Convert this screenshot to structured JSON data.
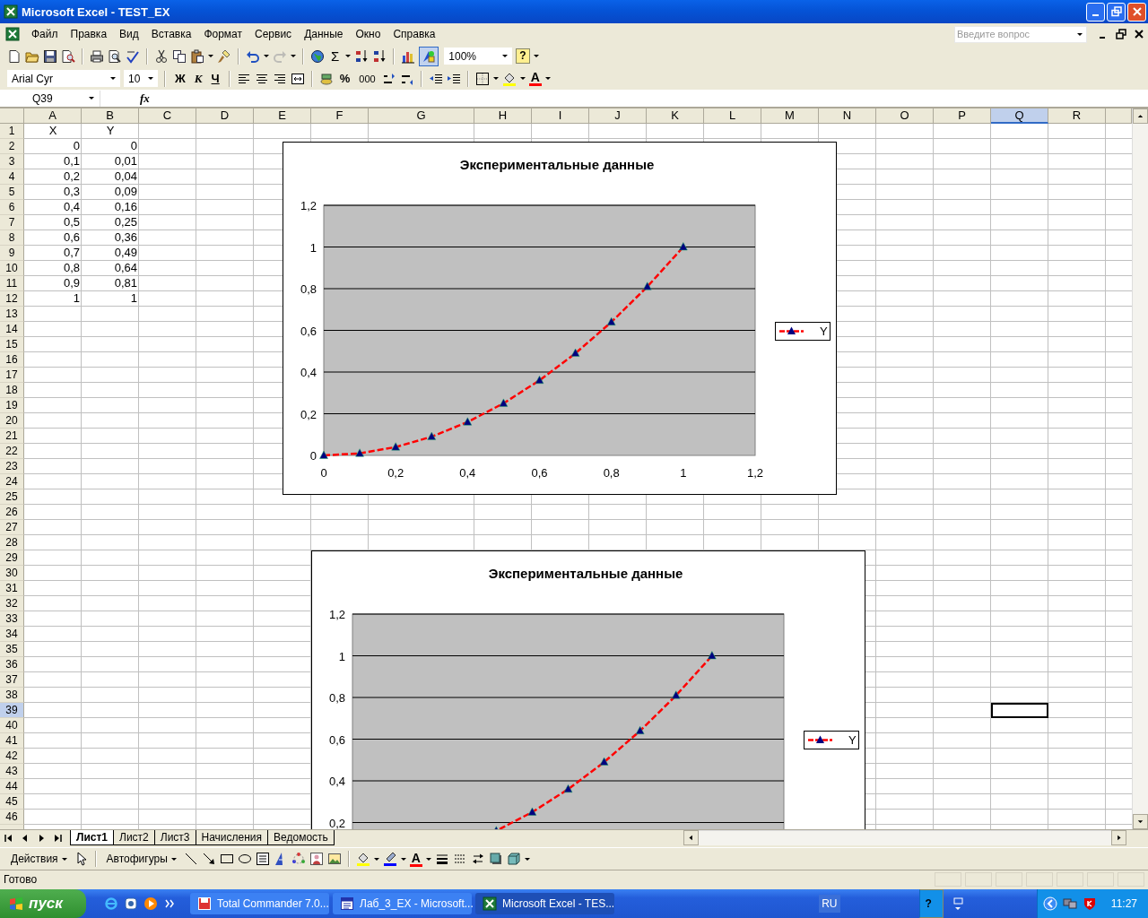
{
  "window": {
    "title": "Microsoft Excel - TEST_EX"
  },
  "menu": [
    "Файл",
    "Правка",
    "Вид",
    "Вставка",
    "Формат",
    "Сервис",
    "Данные",
    "Окно",
    "Справка"
  ],
  "help_search": {
    "placeholder": "Введите вопрос"
  },
  "standard_toolbar": {
    "sum": "Σ",
    "zoom": "100%",
    "help": "?"
  },
  "formatting_toolbar": {
    "font": "Arial Cyr",
    "size": "10",
    "bold": "Ж",
    "italic": "К",
    "underline": "Ч",
    "percent": "%",
    "thousands": "000",
    "font_color": "A"
  },
  "formula_bar": {
    "name_box": "Q39",
    "function_label": "fx"
  },
  "sheet": {
    "columns": [
      {
        "label": "A",
        "selected": false
      },
      {
        "label": "B",
        "selected": false
      },
      {
        "label": "C",
        "selected": false
      },
      {
        "label": "D",
        "selected": false
      },
      {
        "label": "E",
        "selected": false
      },
      {
        "label": "F",
        "selected": false
      },
      {
        "label": "G",
        "selected": false
      },
      {
        "label": "H",
        "selected": false
      },
      {
        "label": "I",
        "selected": false
      },
      {
        "label": "J",
        "selected": false
      },
      {
        "label": "K",
        "selected": false
      },
      {
        "label": "L",
        "selected": false
      },
      {
        "label": "M",
        "selected": false
      },
      {
        "label": "N",
        "selected": false
      },
      {
        "label": "O",
        "selected": false
      },
      {
        "label": "P",
        "selected": false
      },
      {
        "label": "Q",
        "selected": true
      },
      {
        "label": "R",
        "selected": false
      }
    ],
    "rows": [
      {
        "label": "1",
        "selected": false,
        "kind": "label",
        "cells": [
          "X",
          "Y"
        ]
      },
      {
        "label": "2",
        "selected": false,
        "kind": "number",
        "cells": [
          "0",
          "0"
        ]
      },
      {
        "label": "3",
        "selected": false,
        "kind": "number",
        "cells": [
          "0,1",
          "0,01"
        ]
      },
      {
        "label": "4",
        "selected": false,
        "kind": "number",
        "cells": [
          "0,2",
          "0,04"
        ]
      },
      {
        "label": "5",
        "selected": false,
        "kind": "number",
        "cells": [
          "0,3",
          "0,09"
        ]
      },
      {
        "label": "6",
        "selected": false,
        "kind": "number",
        "cells": [
          "0,4",
          "0,16"
        ]
      },
      {
        "label": "7",
        "selected": false,
        "kind": "number",
        "cells": [
          "0,5",
          "0,25"
        ]
      },
      {
        "label": "8",
        "selected": false,
        "kind": "number",
        "cells": [
          "0,6",
          "0,36"
        ]
      },
      {
        "label": "9",
        "selected": false,
        "kind": "number",
        "cells": [
          "0,7",
          "0,49"
        ]
      },
      {
        "label": "10",
        "selected": false,
        "kind": "number",
        "cells": [
          "0,8",
          "0,64"
        ]
      },
      {
        "label": "11",
        "selected": false,
        "kind": "number",
        "cells": [
          "0,9",
          "0,81"
        ]
      },
      {
        "label": "12",
        "selected": false,
        "kind": "number",
        "cells": [
          "1",
          "1"
        ]
      },
      {
        "label": "13",
        "selected": false,
        "kind": "empty"
      },
      {
        "label": "14",
        "selected": false,
        "kind": "empty"
      },
      {
        "label": "15",
        "selected": false,
        "kind": "empty"
      },
      {
        "label": "16",
        "selected": false,
        "kind": "empty"
      },
      {
        "label": "17",
        "selected": false,
        "kind": "empty"
      },
      {
        "label": "18",
        "selected": false,
        "kind": "empty"
      },
      {
        "label": "19",
        "selected": false,
        "kind": "empty"
      },
      {
        "label": "20",
        "selected": false,
        "kind": "empty"
      },
      {
        "label": "21",
        "selected": false,
        "kind": "empty"
      },
      {
        "label": "22",
        "selected": false,
        "kind": "empty"
      },
      {
        "label": "23",
        "selected": false,
        "kind": "empty"
      },
      {
        "label": "24",
        "selected": false,
        "kind": "empty"
      },
      {
        "label": "25",
        "selected": false,
        "kind": "empty"
      },
      {
        "label": "26",
        "selected": false,
        "kind": "empty"
      },
      {
        "label": "27",
        "selected": false,
        "kind": "empty"
      },
      {
        "label": "28",
        "selected": false,
        "kind": "empty"
      },
      {
        "label": "29",
        "selected": false,
        "kind": "empty"
      },
      {
        "label": "30",
        "selected": false,
        "kind": "empty"
      },
      {
        "label": "31",
        "selected": false,
        "kind": "empty"
      },
      {
        "label": "32",
        "selected": false,
        "kind": "empty"
      },
      {
        "label": "33",
        "selected": false,
        "kind": "empty"
      },
      {
        "label": "34",
        "selected": false,
        "kind": "empty"
      },
      {
        "label": "35",
        "selected": false,
        "kind": "empty"
      },
      {
        "label": "36",
        "selected": false,
        "kind": "empty"
      },
      {
        "label": "37",
        "selected": false,
        "kind": "empty"
      },
      {
        "label": "38",
        "selected": false,
        "kind": "empty"
      },
      {
        "label": "39",
        "selected": true,
        "kind": "empty"
      },
      {
        "label": "40",
        "selected": false,
        "kind": "empty"
      },
      {
        "label": "41",
        "selected": false,
        "kind": "empty"
      },
      {
        "label": "42",
        "selected": false,
        "kind": "empty"
      },
      {
        "label": "43",
        "selected": false,
        "kind": "empty"
      },
      {
        "label": "44",
        "selected": false,
        "kind": "empty"
      },
      {
        "label": "45",
        "selected": false,
        "kind": "empty"
      },
      {
        "label": "46",
        "selected": false,
        "kind": "empty"
      }
    ]
  },
  "charts": [
    {
      "chart_data": {
        "type": "line",
        "title": "Экспериментальные данные",
        "x": [
          0,
          0.1,
          0.2,
          0.3,
          0.4,
          0.5,
          0.6,
          0.7,
          0.8,
          0.9,
          1
        ],
        "series": [
          {
            "name": "Y",
            "color": "#ff0000",
            "line_style": "dashed",
            "marker": "triangle",
            "values": [
              0,
              0.01,
              0.04,
              0.09,
              0.16,
              0.25,
              0.36,
              0.49,
              0.64,
              0.81,
              1
            ]
          }
        ],
        "grid": true,
        "xlim": [
          0,
          1.2
        ],
        "ylim": [
          0,
          1.2
        ],
        "xticks": [
          {
            "value": 0,
            "label": "0"
          },
          {
            "value": 0.2,
            "label": "0,2"
          },
          {
            "value": 0.4,
            "label": "0,4"
          },
          {
            "value": 0.6,
            "label": "0,6"
          },
          {
            "value": 0.8,
            "label": "0,8"
          },
          {
            "value": 1,
            "label": "1"
          },
          {
            "value": 1.2,
            "label": "1,2"
          }
        ],
        "yticks": [
          {
            "value": 0,
            "label": "0"
          },
          {
            "value": 0.2,
            "label": "0,2"
          },
          {
            "value": 0.4,
            "label": "0,4"
          },
          {
            "value": 0.6,
            "label": "0,6"
          },
          {
            "value": 0.8,
            "label": "0,8"
          },
          {
            "value": 1,
            "label": "1"
          },
          {
            "value": 1.2,
            "label": "1,2"
          }
        ]
      }
    },
    {
      "picture": {
        "kind": "copy_of_first",
        "title": "Экспериментальные данные",
        "y_axis_labels": [
          "1,2",
          "1",
          "0,8",
          "0,6",
          "0,4",
          "0,2"
        ],
        "legend": "Y"
      }
    }
  ],
  "sheet_tabs": [
    {
      "label": "Лист1",
      "selected": true
    },
    {
      "label": "Лист2",
      "selected": false
    },
    {
      "label": "Лист3",
      "selected": false
    },
    {
      "label": "Начисления",
      "selected": false
    },
    {
      "label": "Ведомость",
      "selected": false
    }
  ],
  "drawing_toolbar": {
    "actions": "Действия",
    "autoshapes": "Автофигуры",
    "font_color": "A"
  },
  "status_bar": "Готово",
  "taskbar": {
    "start": "пуск",
    "tasks": [
      {
        "label": "Total Commander 7.0...",
        "kind": "commander",
        "selected": false
      },
      {
        "label": "Лаб_3_EX - Microsoft...",
        "kind": "word",
        "selected": false
      },
      {
        "label": "Microsoft Excel - TES...",
        "kind": "excel",
        "selected": true
      }
    ],
    "language": "RU",
    "help": "?",
    "clock": "11:27"
  }
}
